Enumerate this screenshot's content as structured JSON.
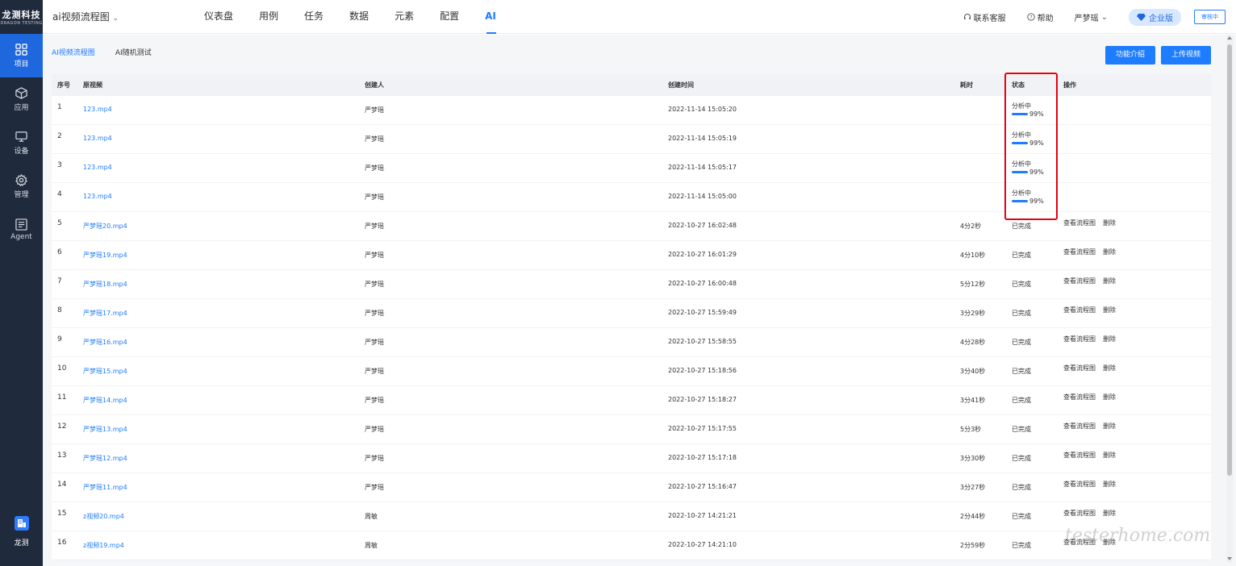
{
  "brand": {
    "name": "龙测科技",
    "subtitle": "DRAGON TESTING"
  },
  "sidebar": {
    "items": [
      {
        "label": "项目",
        "icon": "grid-icon",
        "active": true
      },
      {
        "label": "应用",
        "icon": "box-icon",
        "active": false
      },
      {
        "label": "设备",
        "icon": "monitor-icon",
        "active": false
      },
      {
        "label": "管理",
        "icon": "gear-icon",
        "active": false
      },
      {
        "label": "Agent",
        "icon": "agent-icon",
        "active": false
      }
    ],
    "bottom": {
      "label": "龙测",
      "icon": "building-icon"
    }
  },
  "header": {
    "project": "ai视频流程图",
    "nav": [
      "仪表盘",
      "用例",
      "任务",
      "数据",
      "元素",
      "配置",
      "AI"
    ],
    "active_nav": "AI",
    "support": "联系客服",
    "help": "帮助",
    "user": "严梦瑶",
    "plan": "企业版",
    "mini_button": "审核中"
  },
  "tabs": [
    "AI视频流程图",
    "AI随机测试"
  ],
  "buttons": {
    "intro": "功能介绍",
    "upload": "上传视频"
  },
  "table": {
    "columns": [
      "序号",
      "原视频",
      "创建人",
      "创建时间",
      "耗时",
      "状态",
      "操作"
    ],
    "rows": [
      {
        "seq": "1",
        "file": "123.mp4",
        "creator": "严梦瑶",
        "time": "2022-11-14 15:05:20",
        "duration": "",
        "status": "分析中",
        "progress": "99%",
        "ops": []
      },
      {
        "seq": "2",
        "file": "123.mp4",
        "creator": "严梦瑶",
        "time": "2022-11-14 15:05:19",
        "duration": "",
        "status": "分析中",
        "progress": "99%",
        "ops": []
      },
      {
        "seq": "3",
        "file": "123.mp4",
        "creator": "严梦瑶",
        "time": "2022-11-14 15:05:17",
        "duration": "",
        "status": "分析中",
        "progress": "99%",
        "ops": []
      },
      {
        "seq": "4",
        "file": "123.mp4",
        "creator": "严梦瑶",
        "time": "2022-11-14 15:05:00",
        "duration": "",
        "status": "分析中",
        "progress": "99%",
        "ops": []
      },
      {
        "seq": "5",
        "file": "严梦瑶20.mp4",
        "creator": "严梦瑶",
        "time": "2022-10-27 16:02:48",
        "duration": "4分2秒",
        "status": "已完成",
        "progress": "",
        "ops": [
          "查看流程图",
          "删除"
        ]
      },
      {
        "seq": "6",
        "file": "严梦瑶19.mp4",
        "creator": "严梦瑶",
        "time": "2022-10-27 16:01:29",
        "duration": "4分10秒",
        "status": "已完成",
        "progress": "",
        "ops": [
          "查看流程图",
          "删除"
        ]
      },
      {
        "seq": "7",
        "file": "严梦瑶18.mp4",
        "creator": "严梦瑶",
        "time": "2022-10-27 16:00:48",
        "duration": "5分12秒",
        "status": "已完成",
        "progress": "",
        "ops": [
          "查看流程图",
          "删除"
        ]
      },
      {
        "seq": "8",
        "file": "严梦瑶17.mp4",
        "creator": "严梦瑶",
        "time": "2022-10-27 15:59:49",
        "duration": "3分29秒",
        "status": "已完成",
        "progress": "",
        "ops": [
          "查看流程图",
          "删除"
        ]
      },
      {
        "seq": "9",
        "file": "严梦瑶16.mp4",
        "creator": "严梦瑶",
        "time": "2022-10-27 15:58:55",
        "duration": "4分28秒",
        "status": "已完成",
        "progress": "",
        "ops": [
          "查看流程图",
          "删除"
        ]
      },
      {
        "seq": "10",
        "file": "严梦瑶15.mp4",
        "creator": "严梦瑶",
        "time": "2022-10-27 15:18:56",
        "duration": "3分40秒",
        "status": "已完成",
        "progress": "",
        "ops": [
          "查看流程图",
          "删除"
        ]
      },
      {
        "seq": "11",
        "file": "严梦瑶14.mp4",
        "creator": "严梦瑶",
        "time": "2022-10-27 15:18:27",
        "duration": "3分41秒",
        "status": "已完成",
        "progress": "",
        "ops": [
          "查看流程图",
          "删除"
        ]
      },
      {
        "seq": "12",
        "file": "严梦瑶13.mp4",
        "creator": "严梦瑶",
        "time": "2022-10-27 15:17:55",
        "duration": "5分3秒",
        "status": "已完成",
        "progress": "",
        "ops": [
          "查看流程图",
          "删除"
        ]
      },
      {
        "seq": "13",
        "file": "严梦瑶12.mp4",
        "creator": "严梦瑶",
        "time": "2022-10-27 15:17:18",
        "duration": "3分30秒",
        "status": "已完成",
        "progress": "",
        "ops": [
          "查看流程图",
          "删除"
        ]
      },
      {
        "seq": "14",
        "file": "严梦瑶11.mp4",
        "creator": "严梦瑶",
        "time": "2022-10-27 15:16:47",
        "duration": "3分27秒",
        "status": "已完成",
        "progress": "",
        "ops": [
          "查看流程图",
          "删除"
        ]
      },
      {
        "seq": "15",
        "file": "z视频20.mp4",
        "creator": "周敏",
        "time": "2022-10-27 14:21:21",
        "duration": "2分44秒",
        "status": "已完成",
        "progress": "",
        "ops": [
          "查看流程图",
          "删除"
        ]
      },
      {
        "seq": "16",
        "file": "z视频19.mp4",
        "creator": "周敏",
        "time": "2022-10-27 14:21:10",
        "duration": "2分59秒",
        "status": "已完成",
        "progress": "",
        "ops": [
          "查看流程图",
          "删除"
        ]
      }
    ]
  },
  "watermark": "testerhome.com",
  "colors": {
    "sidebar_bg": "#1f2a3c",
    "accent": "#1e7cff",
    "highlight": "#e60012"
  }
}
